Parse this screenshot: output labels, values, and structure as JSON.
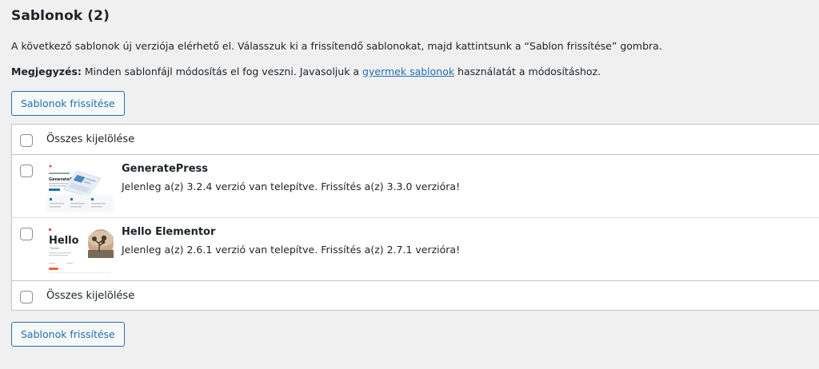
{
  "page": {
    "heading": "Sablonok (2)",
    "intro": "A következő sablonok új verziója elérhető el. Válasszuk ki a frissítendő sablonokat, majd kattintsunk a “Sablon frissítése” gombra.",
    "note_label": "Megjegyzés:",
    "note_before": " Minden sablonfájl módosítás el fog veszni. Javasoljuk a ",
    "note_link": "gyermek sablonok",
    "note_after": " használatát a módosításhoz.",
    "update_button": "Sablonok frissítése"
  },
  "table": {
    "select_all": "Összes kijelölése",
    "themes": [
      {
        "name": "GeneratePress",
        "description": "Jelenleg a(z) 3.2.4 verzió van telepítve. Frissítés a(z) 3.3.0 verzióra!",
        "thumb_title": "GeneratePress"
      },
      {
        "name": "Hello Elementor",
        "description": "Jelenleg a(z) 2.6.1 verzió van telepítve. Frissítés a(z) 2.7.1 verzióra!",
        "thumb_title": "Hello",
        "thumb_sub": "Theme"
      }
    ]
  },
  "colors": {
    "accent": "#2271b1",
    "background": "#f0f0f1",
    "border": "#c3c4c7"
  }
}
